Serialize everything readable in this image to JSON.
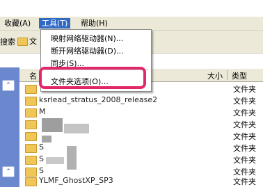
{
  "menubar": {
    "favorites": "收藏(A)",
    "tools": "工具(T)",
    "help": "帮助(H)"
  },
  "toolbar": {
    "search_label": "搜索",
    "folders_label": "文"
  },
  "tools_menu": {
    "items": [
      {
        "label": "映射网络驱动器(N)..."
      },
      {
        "label": "断开网络驱动器(D)..."
      },
      {
        "label": "同步(S)..."
      },
      {
        "label": "文件夹选项(O)..."
      }
    ]
  },
  "list": {
    "columns": {
      "name": "名",
      "size": "大小",
      "type": "类型"
    },
    "rows": [
      {
        "name": "",
        "type": "文件夹"
      },
      {
        "name": "ksrlead_stratus_2008_release2",
        "type": "文件夹"
      },
      {
        "name": "M",
        "type": "文件夹"
      },
      {
        "name": "",
        "type": "文件夹"
      },
      {
        "name": "",
        "type": "文件夹"
      },
      {
        "name": "S",
        "type": "文件夹"
      },
      {
        "name": "S",
        "type": "文件夹"
      },
      {
        "name": "S",
        "type": "文件夹"
      },
      {
        "name": "",
        "type": "文件夹"
      },
      {
        "name": "YLMF_GhostXP_SP3",
        "type": "文件夹"
      }
    ]
  },
  "leftpane": {
    "collapse_symbol": "⌃"
  },
  "colors": {
    "highlight": "#e2286a",
    "menu_active": "#316ac5",
    "xp_chrome": "#ece9d8",
    "task_pane": "#6b88cf"
  }
}
